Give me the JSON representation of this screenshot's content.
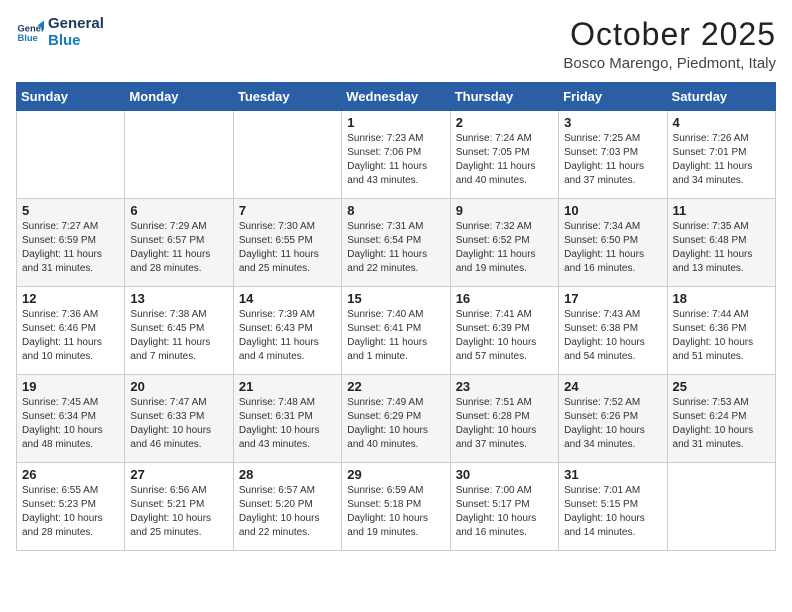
{
  "logo": {
    "line1": "General",
    "line2": "Blue"
  },
  "title": "October 2025",
  "subtitle": "Bosco Marengo, Piedmont, Italy",
  "weekdays": [
    "Sunday",
    "Monday",
    "Tuesday",
    "Wednesday",
    "Thursday",
    "Friday",
    "Saturday"
  ],
  "weeks": [
    [
      {
        "day": "",
        "info": ""
      },
      {
        "day": "",
        "info": ""
      },
      {
        "day": "",
        "info": ""
      },
      {
        "day": "1",
        "info": "Sunrise: 7:23 AM\nSunset: 7:06 PM\nDaylight: 11 hours and 43 minutes."
      },
      {
        "day": "2",
        "info": "Sunrise: 7:24 AM\nSunset: 7:05 PM\nDaylight: 11 hours and 40 minutes."
      },
      {
        "day": "3",
        "info": "Sunrise: 7:25 AM\nSunset: 7:03 PM\nDaylight: 11 hours and 37 minutes."
      },
      {
        "day": "4",
        "info": "Sunrise: 7:26 AM\nSunset: 7:01 PM\nDaylight: 11 hours and 34 minutes."
      }
    ],
    [
      {
        "day": "5",
        "info": "Sunrise: 7:27 AM\nSunset: 6:59 PM\nDaylight: 11 hours and 31 minutes."
      },
      {
        "day": "6",
        "info": "Sunrise: 7:29 AM\nSunset: 6:57 PM\nDaylight: 11 hours and 28 minutes."
      },
      {
        "day": "7",
        "info": "Sunrise: 7:30 AM\nSunset: 6:55 PM\nDaylight: 11 hours and 25 minutes."
      },
      {
        "day": "8",
        "info": "Sunrise: 7:31 AM\nSunset: 6:54 PM\nDaylight: 11 hours and 22 minutes."
      },
      {
        "day": "9",
        "info": "Sunrise: 7:32 AM\nSunset: 6:52 PM\nDaylight: 11 hours and 19 minutes."
      },
      {
        "day": "10",
        "info": "Sunrise: 7:34 AM\nSunset: 6:50 PM\nDaylight: 11 hours and 16 minutes."
      },
      {
        "day": "11",
        "info": "Sunrise: 7:35 AM\nSunset: 6:48 PM\nDaylight: 11 hours and 13 minutes."
      }
    ],
    [
      {
        "day": "12",
        "info": "Sunrise: 7:36 AM\nSunset: 6:46 PM\nDaylight: 11 hours and 10 minutes."
      },
      {
        "day": "13",
        "info": "Sunrise: 7:38 AM\nSunset: 6:45 PM\nDaylight: 11 hours and 7 minutes."
      },
      {
        "day": "14",
        "info": "Sunrise: 7:39 AM\nSunset: 6:43 PM\nDaylight: 11 hours and 4 minutes."
      },
      {
        "day": "15",
        "info": "Sunrise: 7:40 AM\nSunset: 6:41 PM\nDaylight: 11 hours and 1 minute."
      },
      {
        "day": "16",
        "info": "Sunrise: 7:41 AM\nSunset: 6:39 PM\nDaylight: 10 hours and 57 minutes."
      },
      {
        "day": "17",
        "info": "Sunrise: 7:43 AM\nSunset: 6:38 PM\nDaylight: 10 hours and 54 minutes."
      },
      {
        "day": "18",
        "info": "Sunrise: 7:44 AM\nSunset: 6:36 PM\nDaylight: 10 hours and 51 minutes."
      }
    ],
    [
      {
        "day": "19",
        "info": "Sunrise: 7:45 AM\nSunset: 6:34 PM\nDaylight: 10 hours and 48 minutes."
      },
      {
        "day": "20",
        "info": "Sunrise: 7:47 AM\nSunset: 6:33 PM\nDaylight: 10 hours and 46 minutes."
      },
      {
        "day": "21",
        "info": "Sunrise: 7:48 AM\nSunset: 6:31 PM\nDaylight: 10 hours and 43 minutes."
      },
      {
        "day": "22",
        "info": "Sunrise: 7:49 AM\nSunset: 6:29 PM\nDaylight: 10 hours and 40 minutes."
      },
      {
        "day": "23",
        "info": "Sunrise: 7:51 AM\nSunset: 6:28 PM\nDaylight: 10 hours and 37 minutes."
      },
      {
        "day": "24",
        "info": "Sunrise: 7:52 AM\nSunset: 6:26 PM\nDaylight: 10 hours and 34 minutes."
      },
      {
        "day": "25",
        "info": "Sunrise: 7:53 AM\nSunset: 6:24 PM\nDaylight: 10 hours and 31 minutes."
      }
    ],
    [
      {
        "day": "26",
        "info": "Sunrise: 6:55 AM\nSunset: 5:23 PM\nDaylight: 10 hours and 28 minutes."
      },
      {
        "day": "27",
        "info": "Sunrise: 6:56 AM\nSunset: 5:21 PM\nDaylight: 10 hours and 25 minutes."
      },
      {
        "day": "28",
        "info": "Sunrise: 6:57 AM\nSunset: 5:20 PM\nDaylight: 10 hours and 22 minutes."
      },
      {
        "day": "29",
        "info": "Sunrise: 6:59 AM\nSunset: 5:18 PM\nDaylight: 10 hours and 19 minutes."
      },
      {
        "day": "30",
        "info": "Sunrise: 7:00 AM\nSunset: 5:17 PM\nDaylight: 10 hours and 16 minutes."
      },
      {
        "day": "31",
        "info": "Sunrise: 7:01 AM\nSunset: 5:15 PM\nDaylight: 10 hours and 14 minutes."
      },
      {
        "day": "",
        "info": ""
      }
    ]
  ]
}
